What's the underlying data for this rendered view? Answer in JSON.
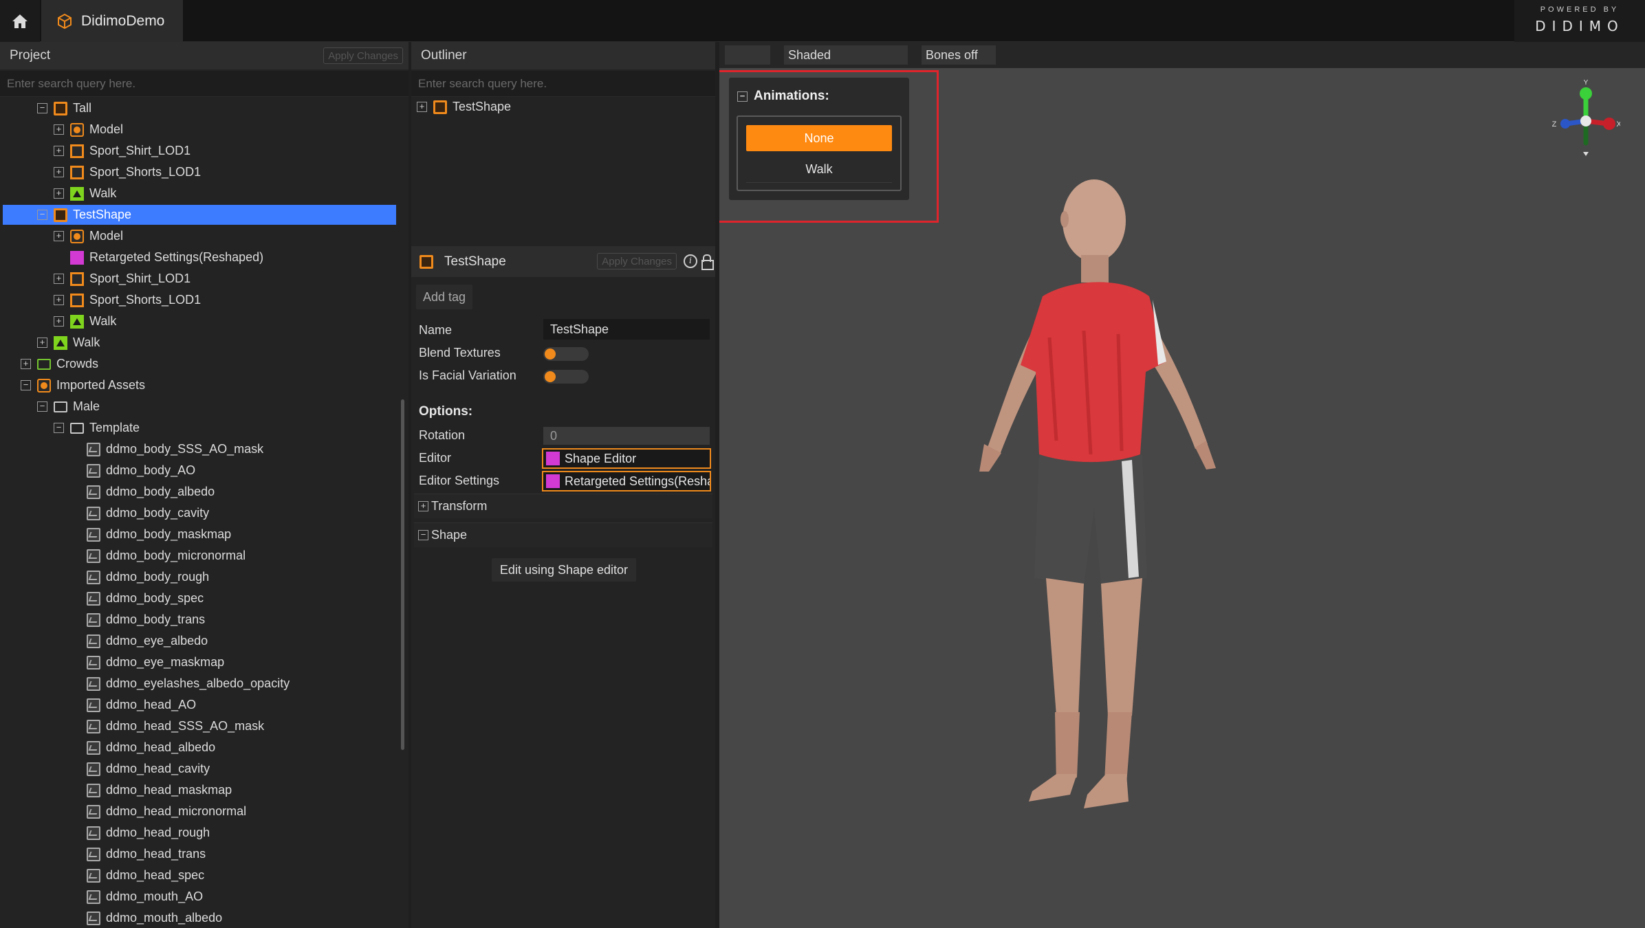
{
  "titlebar": {
    "app_tab": "DidimoDemo",
    "brand_powered": "POWERED BY",
    "brand_logo": "DIDIMO"
  },
  "project": {
    "title": "Project",
    "apply_label": "Apply Changes",
    "search_placeholder": "Enter search query here.",
    "tree": [
      {
        "label": "Tall",
        "indent": 0,
        "toggle": "−",
        "icon": "prefab"
      },
      {
        "label": "Model",
        "indent": 1,
        "toggle": "+",
        "icon": "model"
      },
      {
        "label": "Sport_Shirt_LOD1",
        "indent": 1,
        "toggle": "+",
        "icon": "cloth"
      },
      {
        "label": "Sport_Shorts_LOD1",
        "indent": 1,
        "toggle": "+",
        "icon": "cloth"
      },
      {
        "label": "Walk",
        "indent": 1,
        "toggle": "+",
        "icon": "anim"
      },
      {
        "label": "TestShape",
        "indent": 0,
        "toggle": "−",
        "icon": "prefab",
        "selected": true
      },
      {
        "label": "Model",
        "indent": 1,
        "toggle": "+",
        "icon": "model"
      },
      {
        "label": "Retargeted Settings(Reshaped)",
        "indent": 1,
        "toggle": "",
        "icon": "settings"
      },
      {
        "label": "Sport_Shirt_LOD1",
        "indent": 1,
        "toggle": "+",
        "icon": "cloth"
      },
      {
        "label": "Sport_Shorts_LOD1",
        "indent": 1,
        "toggle": "+",
        "icon": "cloth"
      },
      {
        "label": "Walk",
        "indent": 1,
        "toggle": "+",
        "icon": "anim"
      },
      {
        "label": "Walk",
        "indent": 0,
        "toggle": "+",
        "icon": "anim"
      },
      {
        "label": "Crowds",
        "indent": -1,
        "toggle": "+",
        "icon": "folder-green"
      },
      {
        "label": "Imported Assets",
        "indent": -1,
        "toggle": "−",
        "icon": "model"
      },
      {
        "label": "Male",
        "indent": 0,
        "toggle": "−",
        "icon": "folder"
      },
      {
        "label": "Template",
        "indent": 1,
        "toggle": "−",
        "icon": "folder"
      },
      {
        "label": "ddmo_body_SSS_AO_mask",
        "indent": 2,
        "toggle": "",
        "icon": "texture"
      },
      {
        "label": "ddmo_body_AO",
        "indent": 2,
        "toggle": "",
        "icon": "texture"
      },
      {
        "label": "ddmo_body_albedo",
        "indent": 2,
        "toggle": "",
        "icon": "texture"
      },
      {
        "label": "ddmo_body_cavity",
        "indent": 2,
        "toggle": "",
        "icon": "texture"
      },
      {
        "label": "ddmo_body_maskmap",
        "indent": 2,
        "toggle": "",
        "icon": "texture"
      },
      {
        "label": "ddmo_body_micronormal",
        "indent": 2,
        "toggle": "",
        "icon": "texture"
      },
      {
        "label": "ddmo_body_rough",
        "indent": 2,
        "toggle": "",
        "icon": "texture"
      },
      {
        "label": "ddmo_body_spec",
        "indent": 2,
        "toggle": "",
        "icon": "texture"
      },
      {
        "label": "ddmo_body_trans",
        "indent": 2,
        "toggle": "",
        "icon": "texture"
      },
      {
        "label": "ddmo_eye_albedo",
        "indent": 2,
        "toggle": "",
        "icon": "texture"
      },
      {
        "label": "ddmo_eye_maskmap",
        "indent": 2,
        "toggle": "",
        "icon": "texture"
      },
      {
        "label": "ddmo_eyelashes_albedo_opacity",
        "indent": 2,
        "toggle": "",
        "icon": "texture"
      },
      {
        "label": "ddmo_head_AO",
        "indent": 2,
        "toggle": "",
        "icon": "texture"
      },
      {
        "label": "ddmo_head_SSS_AO_mask",
        "indent": 2,
        "toggle": "",
        "icon": "texture"
      },
      {
        "label": "ddmo_head_albedo",
        "indent": 2,
        "toggle": "",
        "icon": "texture"
      },
      {
        "label": "ddmo_head_cavity",
        "indent": 2,
        "toggle": "",
        "icon": "texture"
      },
      {
        "label": "ddmo_head_maskmap",
        "indent": 2,
        "toggle": "",
        "icon": "texture"
      },
      {
        "label": "ddmo_head_micronormal",
        "indent": 2,
        "toggle": "",
        "icon": "texture"
      },
      {
        "label": "ddmo_head_rough",
        "indent": 2,
        "toggle": "",
        "icon": "texture"
      },
      {
        "label": "ddmo_head_trans",
        "indent": 2,
        "toggle": "",
        "icon": "texture"
      },
      {
        "label": "ddmo_head_spec",
        "indent": 2,
        "toggle": "",
        "icon": "texture"
      },
      {
        "label": "ddmo_mouth_AO",
        "indent": 2,
        "toggle": "",
        "icon": "texture"
      },
      {
        "label": "ddmo_mouth_albedo",
        "indent": 2,
        "toggle": "",
        "icon": "texture"
      }
    ]
  },
  "outliner": {
    "title": "Outliner",
    "search_placeholder": "Enter search query here.",
    "item_label": "TestShape",
    "item_toggle": "+"
  },
  "inspector": {
    "title": "TestShape",
    "apply_label": "Apply Changes",
    "add_tag": "Add tag",
    "name_label": "Name",
    "name_value": "TestShape",
    "blend_label": "Blend Textures",
    "blend_on": false,
    "facial_label": "Is Facial Variation",
    "facial_on": false,
    "options_label": "Options:",
    "rotation_label": "Rotation",
    "rotation_value": "0",
    "editor_label": "Editor",
    "editor_value": "Shape Editor",
    "editor_settings_label": "Editor Settings",
    "editor_settings_value": "Retargeted Settings(Resha",
    "transform_label": "Transform",
    "transform_toggle": "+",
    "shape_label": "Shape",
    "shape_toggle": "−",
    "edit_button": "Edit using Shape editor"
  },
  "viewport": {
    "mode_label": "Shaded",
    "bones_label": "Bones off",
    "animations_title": "Animations:",
    "animations_toggle": "−",
    "anim_options": [
      "None",
      "Walk"
    ],
    "anim_selected": "None",
    "gizmo_axes": {
      "y": "Y",
      "x": "X",
      "z": "Z"
    }
  },
  "colors": {
    "accent_orange": "#ff8a12",
    "selection_blue": "#3d7bff",
    "highlight_red": "#e0242c"
  }
}
